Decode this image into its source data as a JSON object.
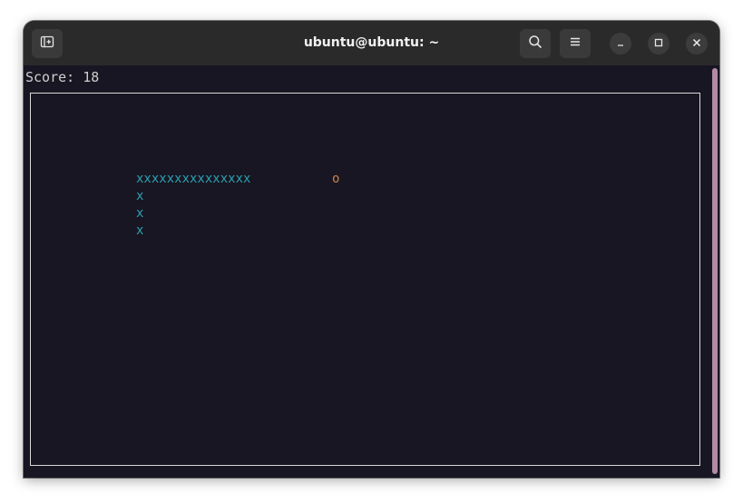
{
  "window": {
    "title": "ubuntu@ubuntu: ~"
  },
  "titlebar": {
    "new_tab_icon": "new-tab-icon",
    "search_icon": "search-icon",
    "menu_icon": "hamburger-menu-icon",
    "minimize_icon": "minimize-icon",
    "maximize_icon": "maximize-icon",
    "close_icon": "close-icon"
  },
  "terminal": {
    "score_text": "Score: 18",
    "snake_segments": [
      "xxxxxxxxxxxxxxx",
      "x",
      "x",
      "x"
    ],
    "food": "o",
    "colors": {
      "background": "#181622",
      "snake": "#2aa1b3",
      "food": "#c9804b",
      "text": "#cfcfcf",
      "border": "#d8d8d8",
      "scrollbar": "#b38aa3"
    }
  }
}
